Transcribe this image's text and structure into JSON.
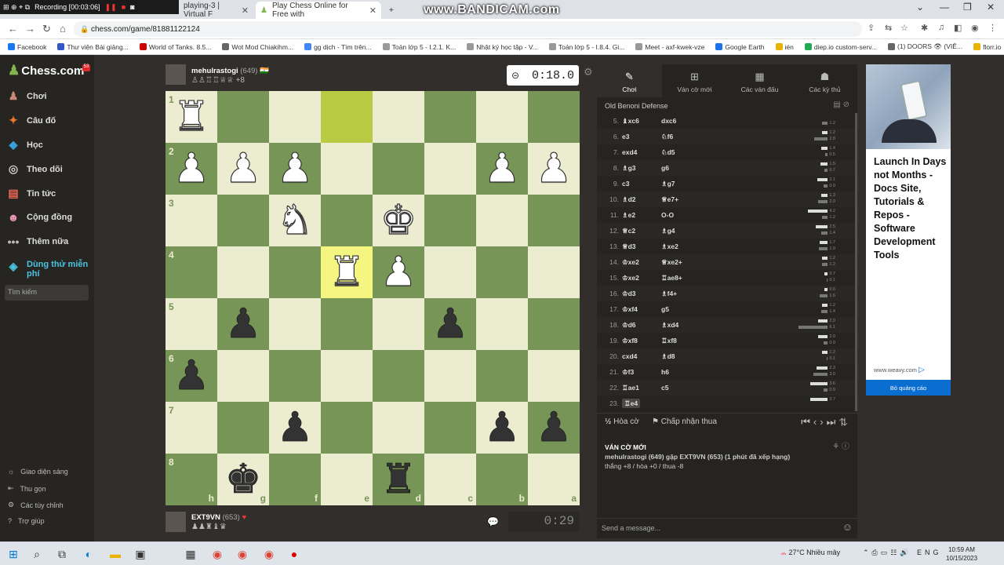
{
  "recorder": {
    "label": "Recording [00:03:06]"
  },
  "watermark": "www.BANDICAM.com",
  "browser": {
    "tabs": [
      {
        "title": "playing-3 | Virtual F"
      },
      {
        "title": "Play Chess Online for Free with"
      }
    ],
    "url": "chess.com/game/81881122124",
    "bookmarks": [
      "Facebook",
      "Thư viện Bài giảng...",
      "World of Tanks. 8.5...",
      "Wot Mod Chiakihm...",
      "gg dịch - Tìm trên...",
      "Toán lớp 5 - I.2.1. K...",
      "Nhật ký học tập - V...",
      "Toán lớp 5 - I.8.4. Gi...",
      "Meet - axf-kwek-vze",
      "Google Earth",
      "ién",
      "diep.io custom-serv...",
      "(1) DOORS 👁 (VIÊ...",
      "florr.io"
    ]
  },
  "sidebar": {
    "logo": "Chess.com",
    "notif": "53",
    "items": [
      {
        "label": "Chơi",
        "icon": "play-icon"
      },
      {
        "label": "Câu đố",
        "icon": "puzzle-icon"
      },
      {
        "label": "Học",
        "icon": "learn-icon"
      },
      {
        "label": "Theo dõi",
        "icon": "watch-icon"
      },
      {
        "label": "Tin tức",
        "icon": "news-icon"
      },
      {
        "label": "Cộng đồng",
        "icon": "community-icon"
      },
      {
        "label": "Thêm nữa",
        "icon": "more-icon"
      },
      {
        "label": "Dùng thử miễn phí",
        "icon": "diamond-icon"
      }
    ],
    "search_placeholder": "Tìm kiếm",
    "bottom": [
      "Giao diện sáng",
      "Thu gọn",
      "Các tùy chỉnh",
      "Trợ giúp"
    ]
  },
  "top_player": {
    "name": "mehulrastogi",
    "rating": "(649)",
    "advantage": "+8",
    "captured": "♙♙♖♖♕♕",
    "clock": "0:18.0"
  },
  "bottom_player": {
    "name": "EXT9VN",
    "rating": "(653)",
    "captured": "♟♟♜♝♛",
    "clock": "0:29"
  },
  "board": {
    "ranks": [
      "1",
      "2",
      "3",
      "4",
      "5",
      "6",
      "7",
      "8"
    ],
    "files": [
      "h",
      "g",
      "f",
      "e",
      "d",
      "c",
      "b",
      "a"
    ],
    "pieces": [
      [
        "wR",
        "",
        "",
        "",
        "",
        "",
        "",
        ""
      ],
      [
        "wP",
        "wP",
        "wP",
        "",
        "",
        "",
        "wP",
        "wP"
      ],
      [
        "",
        "",
        "wN",
        "",
        "wK",
        "",
        "",
        ""
      ],
      [
        "",
        "",
        "",
        "wR",
        "wP",
        "",
        "",
        ""
      ],
      [
        "",
        "bP",
        "",
        "",
        "",
        "bP",
        "",
        ""
      ],
      [
        "bP",
        "",
        "",
        "",
        "",
        "",
        "",
        ""
      ],
      [
        "",
        "",
        "bP",
        "",
        "",
        "",
        "bP",
        "bP"
      ],
      [
        "",
        "bK",
        "",
        "",
        "bR",
        "",
        "",
        ""
      ]
    ],
    "highlights": [
      [
        0,
        3
      ],
      [
        3,
        3
      ]
    ]
  },
  "panel": {
    "tabs": [
      {
        "label": "Chơi",
        "icon": "play-icon"
      },
      {
        "label": "Ván cờ mới",
        "icon": "new-game-icon"
      },
      {
        "label": "Các ván đấu",
        "icon": "games-icon"
      },
      {
        "label": "Các kỳ thủ",
        "icon": "players-icon"
      }
    ],
    "opening": "Old Benoni Defense",
    "moves": [
      {
        "n": "5.",
        "w": "♝xc6",
        "b": "dxc6",
        "tw": "",
        "tb": "1.2"
      },
      {
        "n": "6.",
        "w": "e3",
        "b": "♘f6",
        "tw": "1.2",
        "tb": "2.8"
      },
      {
        "n": "7.",
        "w": "exd4",
        "b": "♘d5",
        "tw": "1.4",
        "tb": "0.5"
      },
      {
        "n": "8.",
        "w": "♗g3",
        "b": "g6",
        "tw": "1.5",
        "tb": "0.7"
      },
      {
        "n": "9.",
        "w": "c3",
        "b": "♗g7",
        "tw": "2.1",
        "tb": "0.9"
      },
      {
        "n": "10.",
        "w": "♗d2",
        "b": "♕e7+",
        "tw": "1.3",
        "tb": "2.0"
      },
      {
        "n": "11.",
        "w": "♗e2",
        "b": "O-O",
        "tw": "4.2",
        "tb": "1.2"
      },
      {
        "n": "12.",
        "w": "♕c2",
        "b": "♗g4",
        "tw": "2.5",
        "tb": "1.4"
      },
      {
        "n": "13.",
        "w": "♕d3",
        "b": "♗xe2",
        "tw": "1.7",
        "tb": "1.9"
      },
      {
        "n": "14.",
        "w": "♔xe2",
        "b": "♕xe2+",
        "tw": "1.2",
        "tb": "1.2"
      },
      {
        "n": "15.",
        "w": "♔xe2",
        "b": "♖ae8+",
        "tw": "0.7",
        "tb": "0.1"
      },
      {
        "n": "16.",
        "w": "♔d3",
        "b": "♗f4+",
        "tw": "0.6",
        "tb": "1.6"
      },
      {
        "n": "17.",
        "w": "♔xf4",
        "b": "g5",
        "tw": "1.2",
        "tb": "1.4"
      },
      {
        "n": "18.",
        "w": "♔d6",
        "b": "♗xd4",
        "tw": "2.0",
        "tb": "6.1"
      },
      {
        "n": "19.",
        "w": "♔xf8",
        "b": "♖xf8",
        "tw": "2.0",
        "tb": "0.9"
      },
      {
        "n": "20.",
        "w": "cxd4",
        "b": "♗d8",
        "tw": "1.2",
        "tb": "0.1"
      },
      {
        "n": "21.",
        "w": "♔f3",
        "b": "h6",
        "tw": "2.3",
        "tb": "3.0"
      },
      {
        "n": "22.",
        "w": "♖ae1",
        "b": "c5",
        "tw": "3.6",
        "tb": "0.9"
      },
      {
        "n": "23.",
        "w": "♖e4",
        "b": "",
        "tw": "3.7",
        "tb": ""
      }
    ],
    "draw": "Hòa cờ",
    "resign": "Chấp nhận thua",
    "new_game_title": "VÁN CỜ MỚI",
    "new_game_desc": "mehulrastogi (649) gặp EXT9VN (653) (1 phút đã xếp hạng)",
    "record": "thắng +8 / hòa +0 / thua -8",
    "chat_placeholder": "Send a message..."
  },
  "ad": {
    "text": "Launch In Days not Months - Docs Site, Tutorials & Repos - Software Development Tools",
    "domain": "www.weavy.com",
    "button": "Bỏ quảng cáo"
  },
  "taskbar": {
    "weather": "27°C  Nhiều mây",
    "lang": "ENG",
    "time": "10:59 AM",
    "date": "10/15/2023"
  }
}
